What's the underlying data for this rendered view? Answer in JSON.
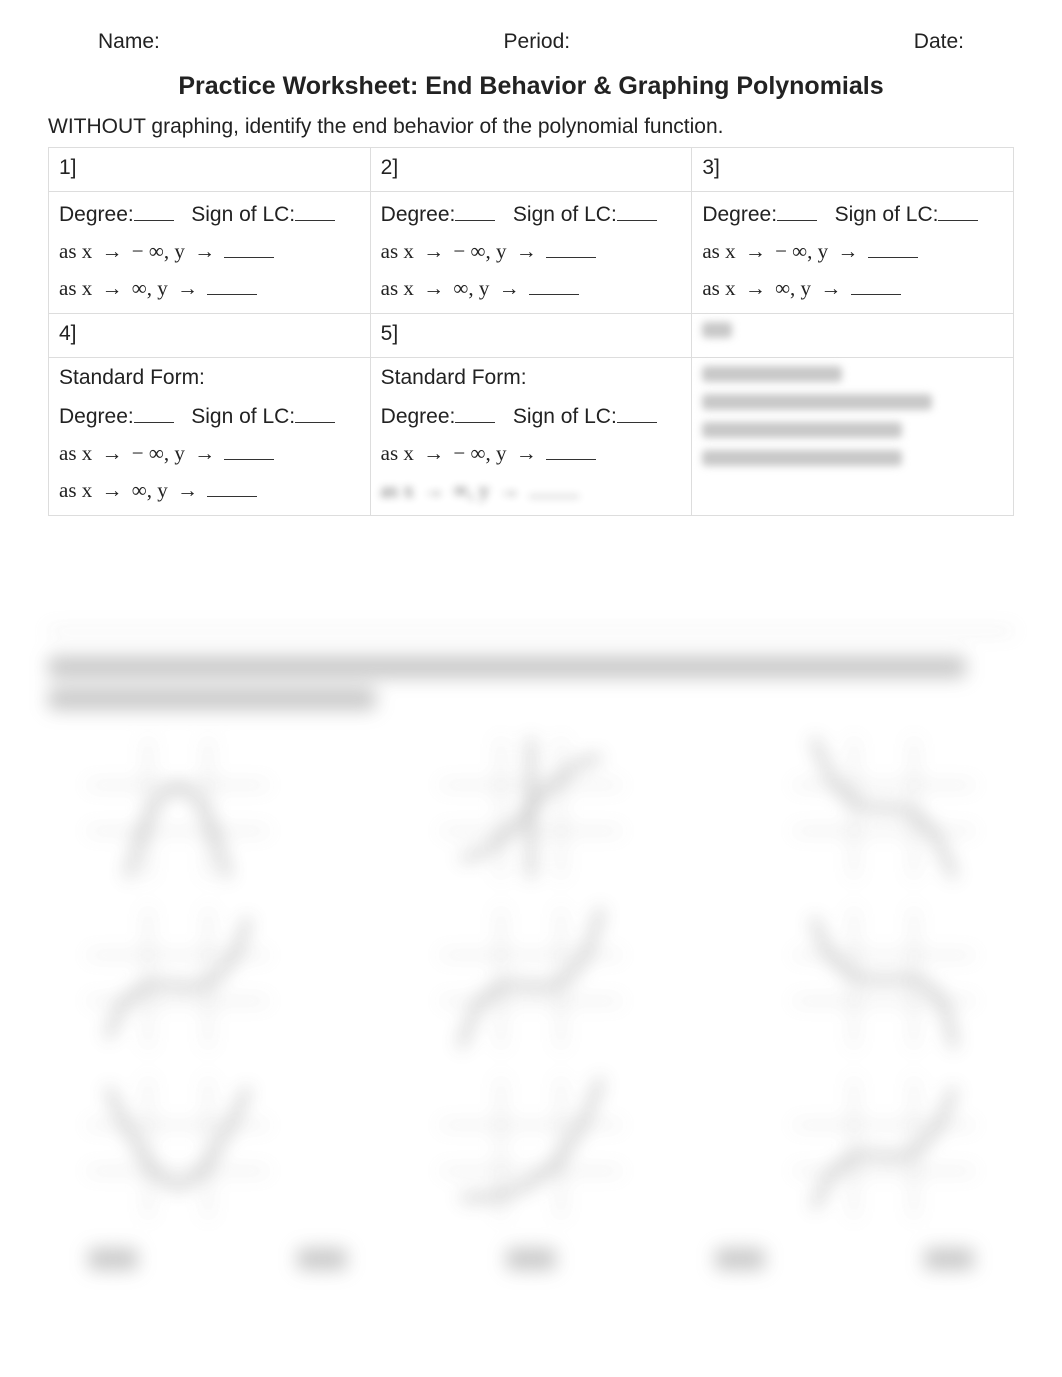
{
  "header": {
    "name_label": "Name:",
    "period_label": "Period:",
    "date_label": "Date:"
  },
  "title": "Practice Worksheet: End Behavior & Graphing Polynomials",
  "instructions": "WITHOUT graphing, identify the end behavior of the polynomial function.",
  "problems": [
    {
      "num": "1]",
      "has_standard_form": false
    },
    {
      "num": "2]",
      "has_standard_form": false
    },
    {
      "num": "3]",
      "has_standard_form": false
    },
    {
      "num": "4]",
      "has_standard_form": true
    },
    {
      "num": "5]",
      "has_standard_form": true
    },
    {
      "num": "",
      "has_standard_form": true,
      "obscured": true
    }
  ],
  "labels": {
    "standard_form": "Standard Form:",
    "degree": "Degree:",
    "sign_lc": "Sign of LC:",
    "as_prefix": "as x",
    "arrow": "→",
    "neg_inf": "− ∞, y",
    "pos_inf": "∞, y"
  }
}
